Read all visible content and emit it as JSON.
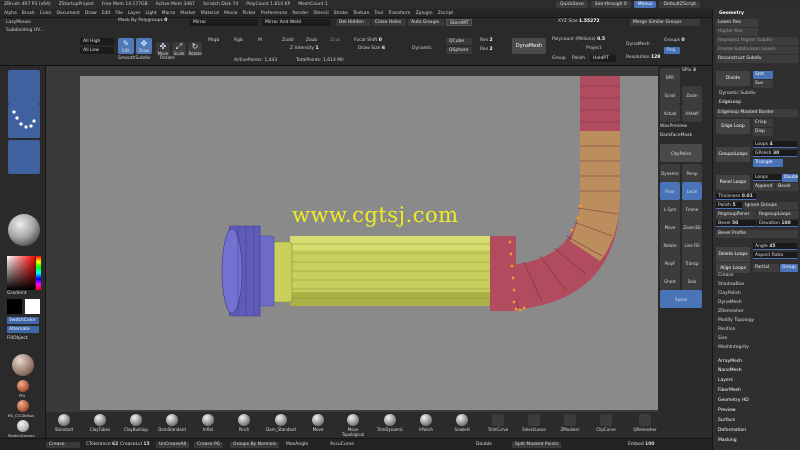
{
  "titlebar": {
    "app": "ZBrush 4R7 P3 (x64)",
    "project": "ZStartupProject",
    "free_mem": "Free Mem 14.177GB",
    "active_mem": "Active Mem 3467",
    "scratch_disk": "Scratch Disk 74",
    "polycount": "PolyCount 1.614 KP",
    "meshcount": "MeshCount 1",
    "quicksave": "QuickSave",
    "see_through": "See-through 0",
    "menus": "Menus",
    "default_zscript": "DefaultZScript"
  },
  "menubar": {
    "items": [
      "Alpha",
      "Brush",
      "Color",
      "Document",
      "Draw",
      "Edit",
      "File",
      "Layer",
      "Light",
      "Macro",
      "Marker",
      "Material",
      "Movie",
      "Picker",
      "Preferences",
      "Render",
      "Stencil",
      "Stroke",
      "Texture",
      "Tool",
      "Transform",
      "Zplugin",
      "Zscript"
    ],
    "right_label": "Geometry"
  },
  "shelf": {
    "lazymouse": "LazyMouse",
    "subdividing": "Subdividing UV...",
    "all_high": "All High",
    "all_low": "All Low",
    "mask_by_polygroups": "Mask By Polygroups",
    "mask_by_polygroups_value": "0",
    "mirror": "Mirror",
    "mirror_and_weld": "Mirror And Weld",
    "del_hidden": "Del Hidden",
    "close_holes": "Close Holes",
    "auto_groups": "Auto Groups",
    "storemt": "StoreMT",
    "xyz_size": "XYZ Size",
    "xyz_size_value": "1.55272",
    "merge_similar_groups": "Merge Similar Groups",
    "edit": "Edit",
    "draw": "Draw",
    "move": "Move",
    "scale": "Scale",
    "rotate": "Rotate",
    "mrgb": "Mrgb",
    "rgb": "Rgb",
    "m": "M",
    "zadd": "Zadd",
    "zsub": "Zsub",
    "zcut": "Zcut",
    "focal_shift": "Focal Shift",
    "focal_shift_value": "0",
    "z_intensity": "Z Intensity",
    "z_intensity_value": "1",
    "draw_size": "Draw Size",
    "draw_size_value": "6",
    "dynamic": "Dynamic",
    "qcube": "QCube",
    "qsphere": "QSphere",
    "res_label": "Res",
    "res_value_1": "2",
    "res_value_2": "2",
    "dynamesh": "DynaMesh",
    "polycount_millions": "Polycount (Millions)",
    "polycount_value": "0.5",
    "project": "Project",
    "group": "Group",
    "polish": "Polish",
    "holdpt": "HoldPT",
    "dynamesh_right": "DynaMesh",
    "resolution": "Resolution",
    "resolution_value": "128",
    "groups": "Groups",
    "groups_value": "0",
    "proj": "Proj",
    "smoothsubdiv": "SmoothSubdiv",
    "rotate_label": "Rotate",
    "active_points": "ActivePoints: 1,443",
    "total_points": "TotalPoints: 1,614 Mil"
  },
  "left_panel": {
    "gradient": "Gradient",
    "switchcolor": "SwitchColor",
    "alternate": "Alternate",
    "fillobject": "FillObject",
    "ball_labels": [
      "PRI",
      "RS_CCCBrBus",
      "SketchGummi"
    ]
  },
  "viewport": {
    "watermark": "www.cgtsj.com"
  },
  "right_column": {
    "icons": [
      "BPR",
      "SPix",
      "Scroll",
      "Zoom",
      "Actual",
      "AAHalf",
      "Dynamic",
      "Persp",
      "Floor",
      "Local",
      "L.Sym",
      "Frame",
      "Move",
      "Zoom3D",
      "Rotate",
      "Line Fill",
      "PolyF",
      "Transp",
      "Ghost",
      "Solo",
      "Xpose"
    ],
    "wax_preview": "WaxPreview",
    "backface_mask": "BackfaceMask",
    "claypolish": "ClayPolish",
    "spix_value": "3"
  },
  "palette": {
    "geometry_header": "Geometry",
    "lower_res": "Lower Res",
    "higher_res": "Higher Res",
    "reproject_higher_subdiv": "Reproject Higher Subdiv",
    "freeze_subdivision_levels": "Freeze Subdivision Levels",
    "reconstruct_subdiv": "Reconstruct Subdiv",
    "divide": "Divide",
    "smt": "Smt",
    "suv": "Suv",
    "dynamic_subdiv": "Dynamic Subdiv",
    "edgeloop": "EdgeLoop",
    "edgeloop_masked_border": "Edgeloop Masked Border",
    "edge_loop": "Edge Loop",
    "crisp": "Crisp",
    "disp": "Disp",
    "groupsloops": "GroupsLoops",
    "loops": "Loops",
    "loops_value": "4",
    "gpolish": "GPolish",
    "gpolish_value": "30",
    "triangle": "Triangle",
    "panel_loops": "Panel Loops",
    "loops2": "Loops",
    "double": "Double",
    "append": "Append",
    "bevel": "Bevel",
    "thickness": "Thickness",
    "thickness_value": "0.01",
    "polish": "Polish",
    "polish_value": "5",
    "ignore_groups": "Ignore Groups",
    "regroup_panel": "RegroupPanel",
    "regroup_loops": "RegroupLoops",
    "bevel_value": "50",
    "elevation": "Elevation",
    "elevation_value": "100",
    "bevel_profile": "Bevel Profile",
    "delete_loops": "Delete Loops",
    "angle": "Angle",
    "angle_value": "45",
    "aspect_ratio": "Aspect Ratio",
    "align_loops": "Align Loops",
    "partial": "Partial",
    "group": "Group",
    "menu_items": [
      "Crease",
      "ShadowBox",
      "ClayPolish",
      "DynaMesh",
      "ZRemesher",
      "Modify Topology",
      "Position",
      "Size",
      "MeshIntegrity",
      "ArrayMesh",
      "NanoMesh",
      "Layers",
      "FiberMesh",
      "Geometry HD",
      "Preview",
      "Surface",
      "Deformation",
      "Masking"
    ]
  },
  "brushes": [
    "Standard",
    "ClayTubes",
    "ClayBuildup",
    "DamStandard",
    "Inflat",
    "Pinch",
    "Dam_Standard",
    "Move",
    "Move Topological",
    "TrimDynamic",
    "hPolish",
    "SnakeH",
    "TrimCurve",
    "SelectLasso",
    "ZModeler",
    "ClipCurve",
    "QRemesher"
  ],
  "statusbar": {
    "crease": "Crease",
    "crease_tolerance": "CTolerance",
    "crease_tolerance_value": "62",
    "creaselvl": "CreaseLvl",
    "creaselvl_value": "15",
    "uncrease_all": "UnCreaseAll",
    "crease_pg": "Crease PG",
    "groups_by_normals": "Groups By Normals",
    "maxangle": "MaxAngle",
    "accucurve": "AccuCurve",
    "double": "Double",
    "split_masked_points": "Split Masked Points",
    "embed": "Embed",
    "embed_value": "100"
  },
  "colors": {
    "accent_blue": "#4a74b8",
    "pipe_yellow": "#c9cf5c",
    "pipe_red": "#b04c5e",
    "cap_purple": "#6e6cc8",
    "canvas_grey": "#8a8a8a"
  }
}
